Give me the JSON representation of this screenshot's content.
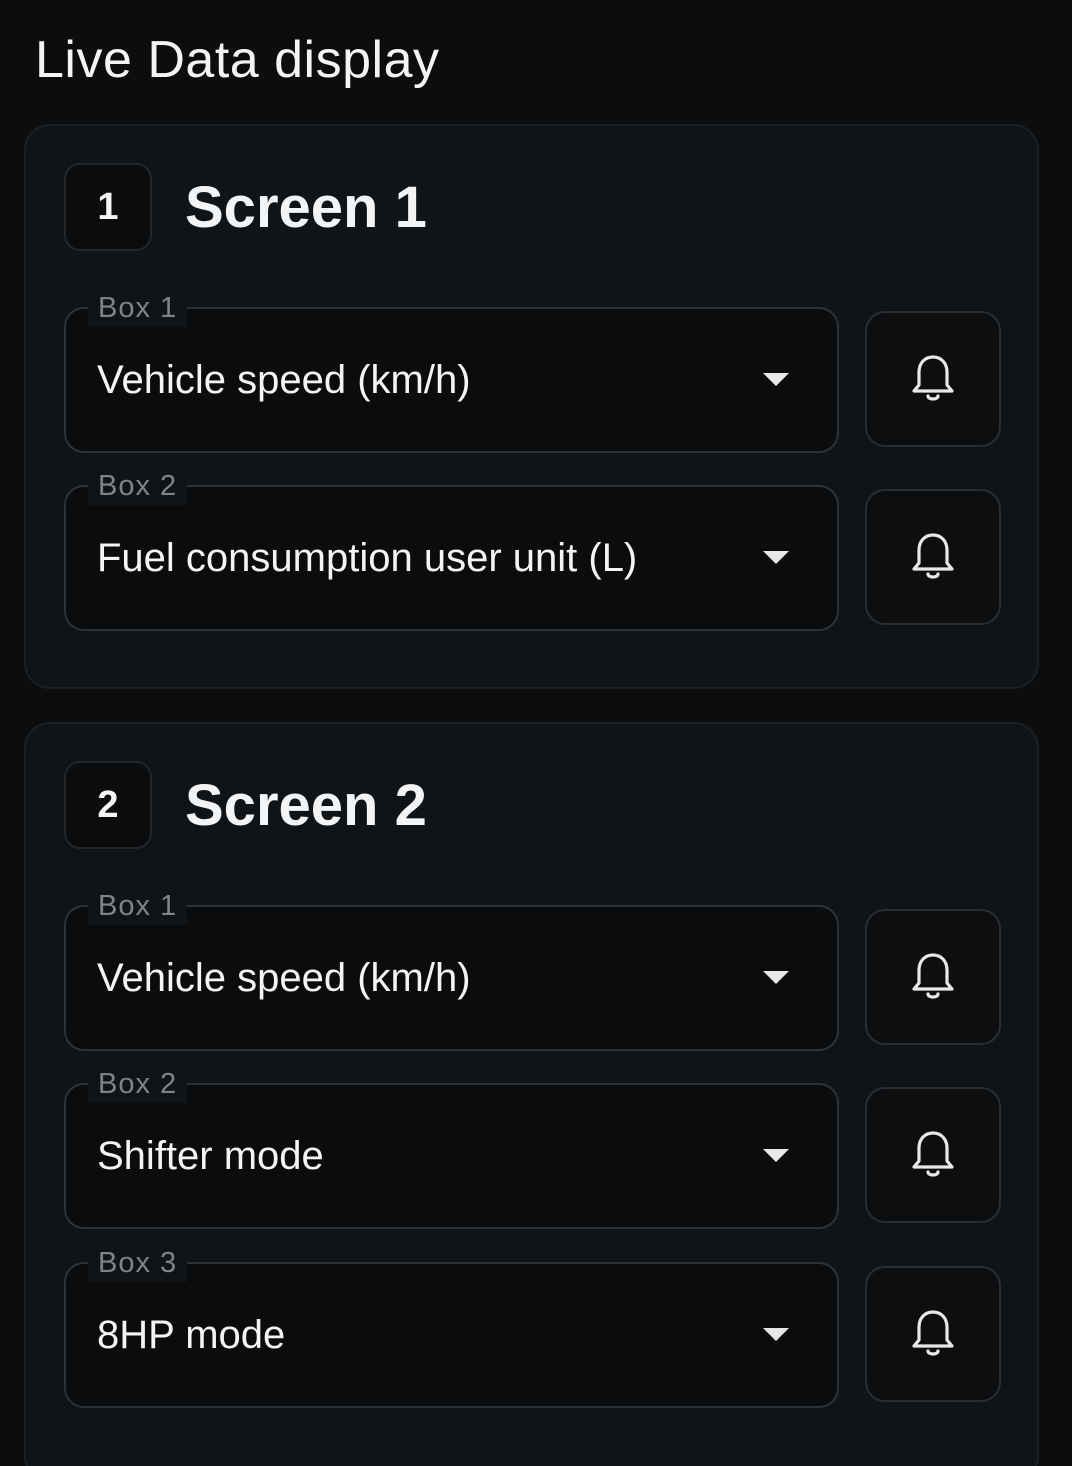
{
  "page_title": "Live Data display",
  "screens": [
    {
      "number": "1",
      "title": "Screen 1",
      "boxes": [
        {
          "label": "Box 1",
          "value": "Vehicle speed (km/h)"
        },
        {
          "label": "Box 2",
          "value": "Fuel consumption user unit (L)"
        }
      ]
    },
    {
      "number": "2",
      "title": "Screen 2",
      "boxes": [
        {
          "label": "Box 1",
          "value": "Vehicle speed (km/h)"
        },
        {
          "label": "Box 2",
          "value": "Shifter mode"
        },
        {
          "label": "Box 3",
          "value": "8HP mode"
        }
      ]
    }
  ],
  "icons": {
    "dropdown": "chevron-down-icon",
    "alert": "bell-icon"
  },
  "colors": {
    "background": "#0b0d0f",
    "card": "#111416",
    "text": "#f2f4f6",
    "label": "#7d848a",
    "border": "#2e3337"
  }
}
